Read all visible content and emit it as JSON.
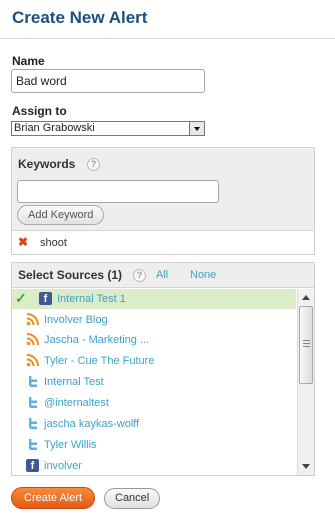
{
  "page": {
    "title": "Create New Alert"
  },
  "form": {
    "name_label": "Name",
    "name_value": "Bad word",
    "assign_label": "Assign to",
    "assign_value": "Brian Grabowski"
  },
  "keywords": {
    "title": "Keywords",
    "help_glyph": "?",
    "input_value": "",
    "add_button": "Add Keyword",
    "remove_glyph": "✖",
    "items": [
      "shoot"
    ]
  },
  "sources": {
    "title": "Select Sources (1)",
    "help_glyph": "?",
    "all_link": "All",
    "none_link": "None",
    "items": [
      {
        "label": "Internal Test 1",
        "icon": "facebook-icon",
        "selected": true
      },
      {
        "label": "Involver Blog",
        "icon": "rss-icon",
        "selected": false
      },
      {
        "label": "Jascha - Marketing ...",
        "icon": "rss-icon",
        "selected": false
      },
      {
        "label": "Tyler - Cue The Future",
        "icon": "rss-icon",
        "selected": false
      },
      {
        "label": "Internal Test",
        "icon": "twitter-icon",
        "selected": false
      },
      {
        "label": "@internaltest",
        "icon": "twitter-icon",
        "selected": false
      },
      {
        "label": "jascha kaykas-wolff",
        "icon": "twitter-icon",
        "selected": false
      },
      {
        "label": "Tyler Willis",
        "icon": "twitter-icon",
        "selected": false
      },
      {
        "label": "involver",
        "icon": "facebook-icon",
        "selected": false
      }
    ]
  },
  "actions": {
    "create": "Create Alert",
    "cancel": "Cancel"
  },
  "colors": {
    "title": "#1d4f7c",
    "link": "#3aa3c9",
    "selected_row": "#dcebc8",
    "primary_button": "#e55a14"
  }
}
